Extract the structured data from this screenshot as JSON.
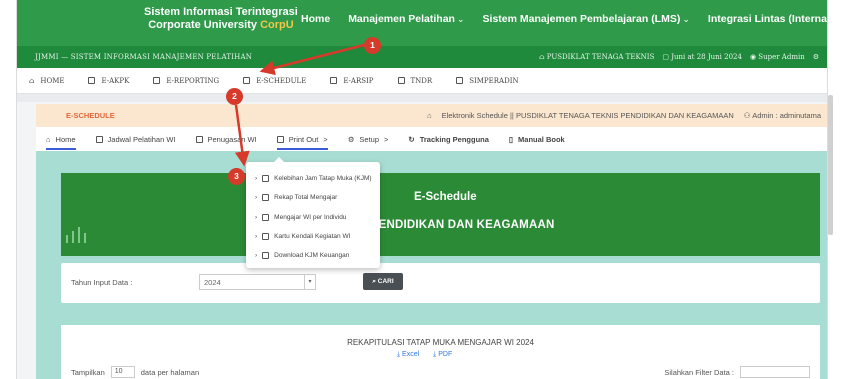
{
  "brand": {
    "line1": "Sistem Informasi Terintegrasi",
    "line2a": "Corporate University",
    "line2b": "CorpU"
  },
  "topnav": [
    {
      "label": "Home",
      "caret": ""
    },
    {
      "label": "Manajemen Pelatihan",
      "caret": "⌄"
    },
    {
      "label": "Sistem Manajemen Pembelajaran (LMS)",
      "caret": "⌄"
    },
    {
      "label": "Integrasi Lintas (Internal & Eksternal)",
      "caret": "⌄"
    }
  ],
  "subbar": {
    "left": "JJMMI — SISTEM INFORMASI MANAJEMEN PELATIHAN",
    "unit": "PUSDIKLAT TENAGA TEKNIS",
    "date": "Juni at 28 Juni 2024",
    "user": "Super Admin"
  },
  "modules": [
    "HOME",
    "E-AKPK",
    "E-REPORTING",
    "E-SCHEDULE",
    "E-ARSIP",
    "TNDR",
    "SIMPERADIN"
  ],
  "eshead": {
    "title": "E-SCHEDULE",
    "info": "Elektronik Schedule || PUSDIKLAT TENAGA TEKNIS PENDIDIKAN DAN KEAGAMAAN",
    "admin": "Admin : adminutama"
  },
  "tabs": {
    "home": "Home",
    "jadwal": "Jadwal Pelatihan WI",
    "penugasan": "Penugasan WI",
    "print": "Print Out",
    "print_caret": ">",
    "setup": "Setup",
    "setup_caret": ">",
    "tracking": "Tracking Pengguna",
    "manual": "Manual Book"
  },
  "hero": {
    "title": "E-Schedule",
    "subtitle_visible": "TEKNIS PENDIDIKAN DAN KEAGAMAAN"
  },
  "filter": {
    "label": "Tahun Input Data :",
    "value": "2024",
    "button": "CARI"
  },
  "table": {
    "title": "REKAPITULASI TATAP MUKA MENGAJAR WI 2024",
    "excel": "Excel",
    "pdf": "PDF",
    "show_label": "Tampilkan",
    "show_value": "10",
    "per_page": "data per halaman",
    "filter_label": "Silahkan Filter Data :"
  },
  "dropdown": [
    "Kelebihan Jam Tatap Muka (KJM)",
    "Rekap Total Mengajar",
    "Mengajar WI per Individu",
    "Kartu Kendali Kegiatan WI",
    "Download KJM Keuangan"
  ],
  "annotations": {
    "b1": "1",
    "b2": "2",
    "b3": "3"
  },
  "colors": {
    "green": "#2f9a4a",
    "dark_green": "#1f8a3b",
    "hero": "#2b8a35",
    "teal": "#a8ddd3",
    "annotation_red": "#d63a2b",
    "peach": "#fbe7cf"
  }
}
